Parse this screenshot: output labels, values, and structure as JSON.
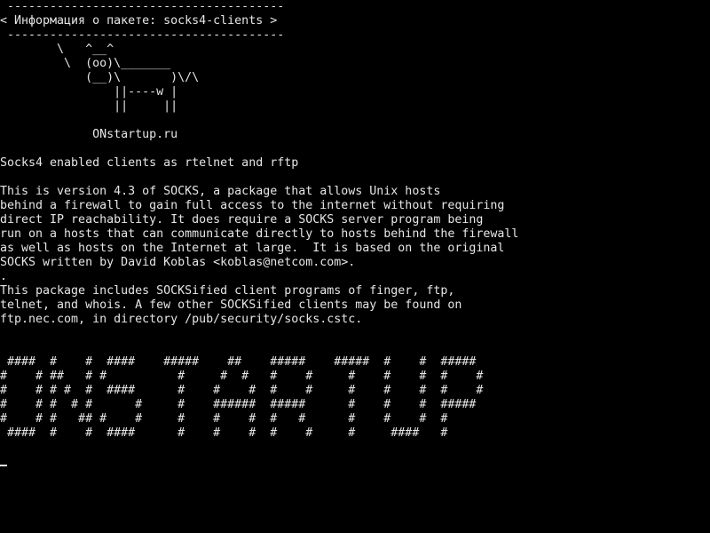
{
  "terminal": {
    "lines": [
      " ---------------------------------------",
      "< Информация о пакете: socks4-clients >",
      " ---------------------------------------",
      "        \\   ^__^",
      "         \\  (oo)\\_______",
      "            (__)\\       )\\/\\",
      "                ||----w |",
      "                ||     ||",
      "",
      "             ONstartup.ru",
      "",
      "Socks4 enabled clients as rtelnet and rftp",
      "",
      "This is version 4.3 of SOCKS, a package that allows Unix hosts",
      "behind a firewall to gain full access to the internet without requiring",
      "direct IP reachability. It does require a SOCKS server program being",
      "run on a hosts that can communicate directly to hosts behind the firewall",
      "as well as hosts on the Internet at large.  It is based on the original",
      "SOCKS written by David Koblas <koblas@netcom.com>.",
      ".",
      "This package includes SOCKSified client programs of finger, ftp,",
      "telnet, and whois. A few other SOCKSified clients may be found on",
      "ftp.nec.com, in directory /pub/security/socks.cstc.",
      "",
      "",
      " ####  #    #  ####    #####    ##    #####    #####  #    #  #####",
      "#    # ##   # #          #     #  #   #    #     #    #    #  #    #",
      "#    # # #  #  ####      #    #    #  #    #     #    #    #  #    #",
      "#    # #  # #      #     #    ######  #####      #    #    #  #####",
      "#    # #   ## #    #     #    #    #  #   #      #    #    #  #",
      " ####  #    #  ####      #    #    #  #    #     #     ####   #"
    ]
  },
  "colors": {
    "background": "#000000",
    "foreground": "#e6e6e6"
  }
}
